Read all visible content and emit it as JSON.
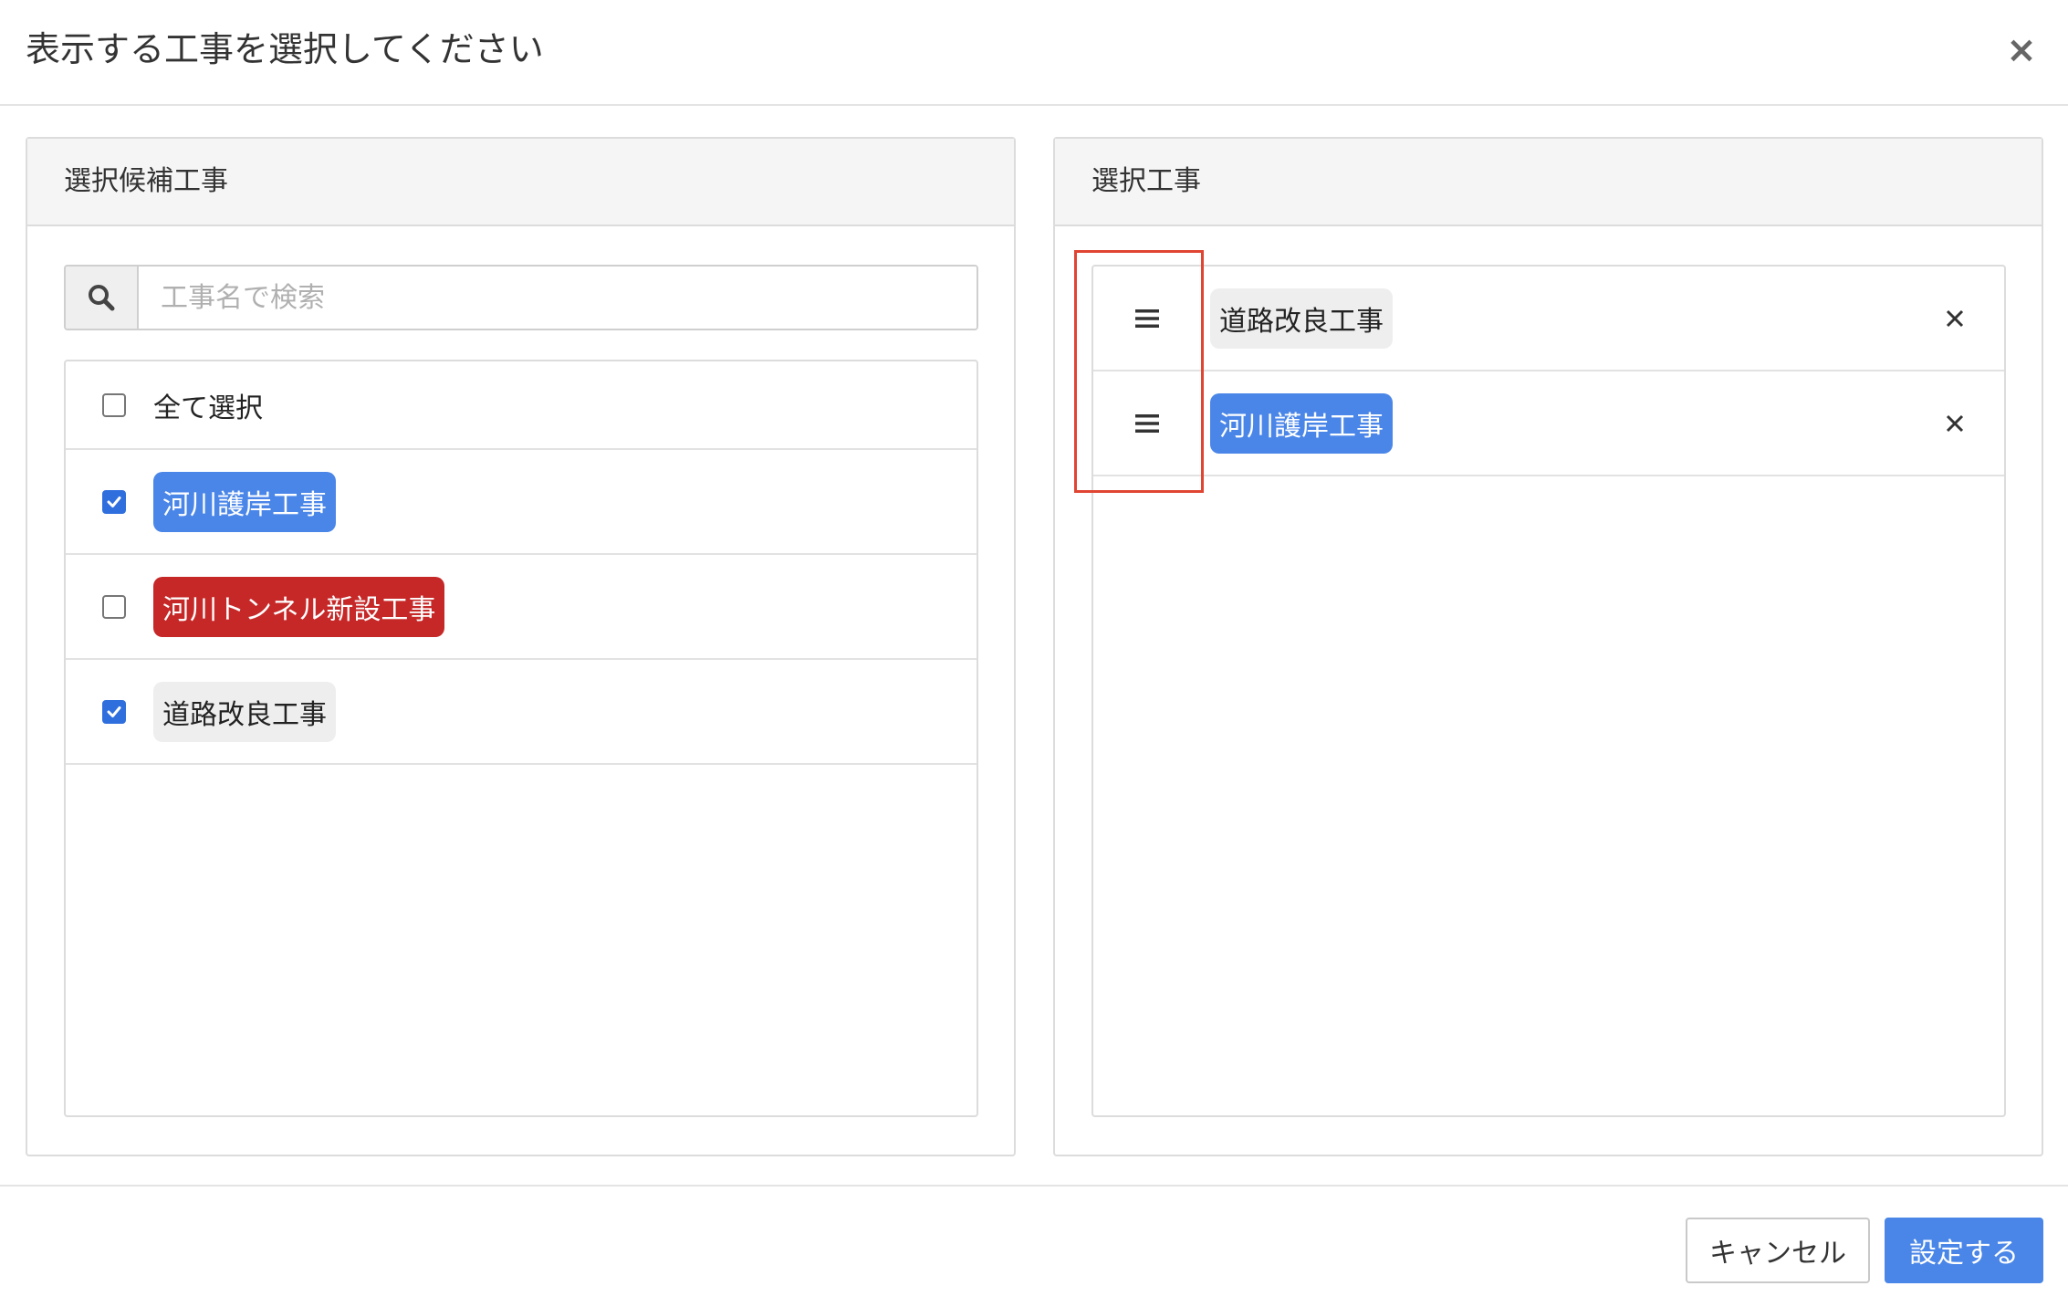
{
  "dialog": {
    "title": "表示する工事を選択してください",
    "close_symbol": "×"
  },
  "left_panel": {
    "heading": "選択候補工事",
    "search": {
      "placeholder": "工事名で検索",
      "value": "",
      "icon": "search-icon"
    },
    "select_all": {
      "label": "全て選択",
      "checked": false
    },
    "items": [
      {
        "label": "河川護岸工事",
        "checked": true,
        "tag_bg": "#4a86e8",
        "tag_fg": "#ffffff"
      },
      {
        "label": "河川トンネル新設工事",
        "checked": false,
        "tag_bg": "#c62828",
        "tag_fg": "#ffffff"
      },
      {
        "label": "道路改良工事",
        "checked": true,
        "tag_bg": "#eeeeee",
        "tag_fg": "#222222"
      }
    ]
  },
  "right_panel": {
    "heading": "選択工事",
    "items": [
      {
        "label": "道路改良工事",
        "tag_bg": "#eeeeee",
        "tag_fg": "#222222",
        "handle_icon": "drag-handle-icon",
        "remove_icon": "close-icon"
      },
      {
        "label": "河川護岸工事",
        "tag_bg": "#4a86e8",
        "tag_fg": "#ffffff",
        "handle_icon": "drag-handle-icon",
        "remove_icon": "close-icon"
      }
    ]
  },
  "footer": {
    "cancel_label": "キャンセル",
    "submit_label": "設定する"
  },
  "colors": {
    "primary": "#4a86e8",
    "checkbox_checked": "#2f6fdd",
    "danger_tag": "#c62828",
    "highlight": "#e04432"
  }
}
